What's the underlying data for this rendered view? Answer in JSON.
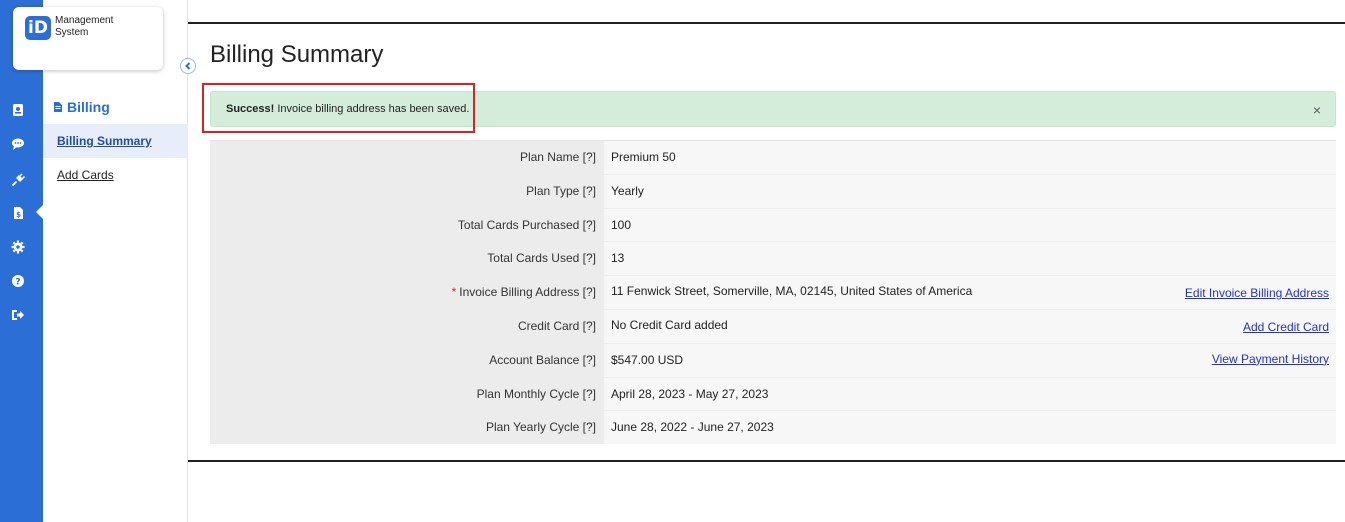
{
  "app": {
    "logo_mark": "iD",
    "logo_text": "Management System"
  },
  "rail": {
    "icons": [
      "id-card-icon",
      "chat-icon",
      "plug-icon",
      "billing-doc-icon",
      "gear-icon",
      "help-icon",
      "logout-icon"
    ],
    "active": "billing-doc-icon",
    "color": "#2b6fd6"
  },
  "sidebar": {
    "heading": "Billing",
    "items": [
      {
        "label": "Billing Summary",
        "active": true
      },
      {
        "label": "Add Cards",
        "active": false
      }
    ]
  },
  "page": {
    "title": "Billing Summary"
  },
  "alert": {
    "strong": "Success!",
    "message": " Invoice billing address has been saved.",
    "close": "×",
    "color": "#d4edda"
  },
  "summary": {
    "rows": [
      {
        "label": "Plan Name [?]",
        "value": "Premium 50",
        "required": false,
        "link": ""
      },
      {
        "label": "Plan Type [?]",
        "value": "Yearly",
        "required": false,
        "link": ""
      },
      {
        "label": "Total Cards Purchased [?]",
        "value": "100",
        "required": false,
        "link": ""
      },
      {
        "label": "Total Cards Used [?]",
        "value": "13",
        "required": false,
        "link": ""
      },
      {
        "label": "Invoice Billing Address [?]",
        "value": "11 Fenwick Street, Somerville, MA, 02145, United States of America",
        "required": true,
        "link": "Edit Invoice Billing Address"
      },
      {
        "label": "Credit Card [?]",
        "value": "No Credit Card added",
        "required": false,
        "link": "Add Credit Card"
      },
      {
        "label": "Account Balance [?]",
        "value": "$547.00 USD",
        "required": false,
        "link": "View Payment History"
      },
      {
        "label": "Plan Monthly Cycle [?]",
        "value": "April 28, 2023 - May 27, 2023",
        "required": false,
        "link": ""
      },
      {
        "label": "Plan Yearly Cycle [?]",
        "value": "June 28, 2022 - June 27, 2023",
        "required": false,
        "link": ""
      }
    ]
  }
}
